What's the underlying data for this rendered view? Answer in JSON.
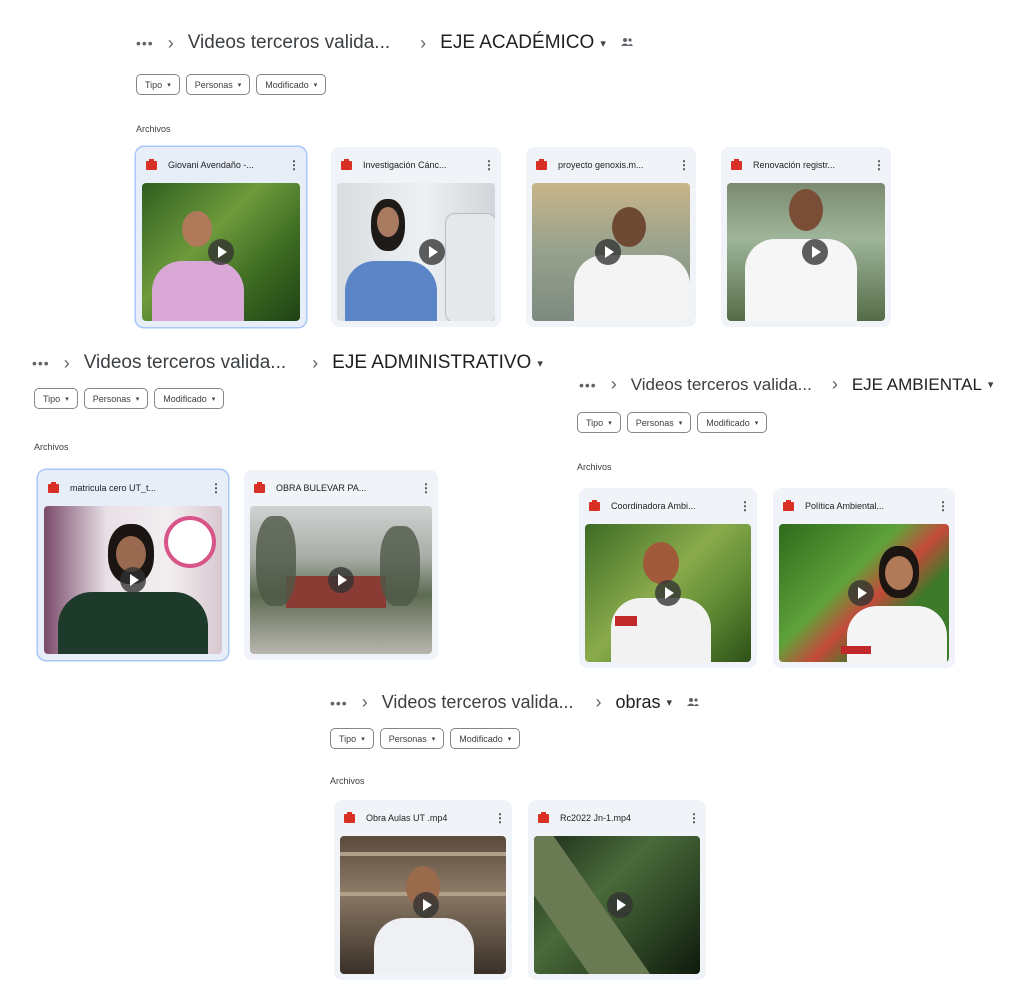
{
  "common": {
    "ellipsis": "•••",
    "separator": "›",
    "parent_folder": "Videos terceros valida...",
    "caret": "▾",
    "filters": {
      "type": "Tipo",
      "people": "Personas",
      "modified": "Modificado"
    },
    "chip_caret": "▾",
    "section_label": "Archivos",
    "more": "⋮"
  },
  "panels": {
    "academico": {
      "folder": "EJE ACADÉMICO",
      "files": [
        {
          "name": "Giovani Avendaño -..."
        },
        {
          "name": "Investigación Cánc..."
        },
        {
          "name": "proyecto genoxis.m..."
        },
        {
          "name": "Renovación registr..."
        }
      ]
    },
    "administrativo": {
      "folder": "EJE ADMINISTRATIVO",
      "files": [
        {
          "name": "matricula cero UT_t..."
        },
        {
          "name": "OBRA BULEVAR PA..."
        }
      ]
    },
    "ambiental": {
      "folder": "EJE AMBIENTAL",
      "files": [
        {
          "name": "Coordinadora Ambi..."
        },
        {
          "name": "Política Ambiental..."
        }
      ]
    },
    "obras": {
      "folder": "obras",
      "files": [
        {
          "name": "Obra Aulas UT .mp4"
        },
        {
          "name": "Rc2022 Jn-1.mp4"
        }
      ]
    }
  },
  "colors": {
    "accent": "#d93025",
    "card_bg": "#f0f4f9",
    "selected_outline": "#a8c7fa"
  },
  "icons": {
    "file_type": "video-file-icon",
    "play": "play-icon",
    "more": "more-vert-icon",
    "shared": "shared-folder-icon"
  }
}
